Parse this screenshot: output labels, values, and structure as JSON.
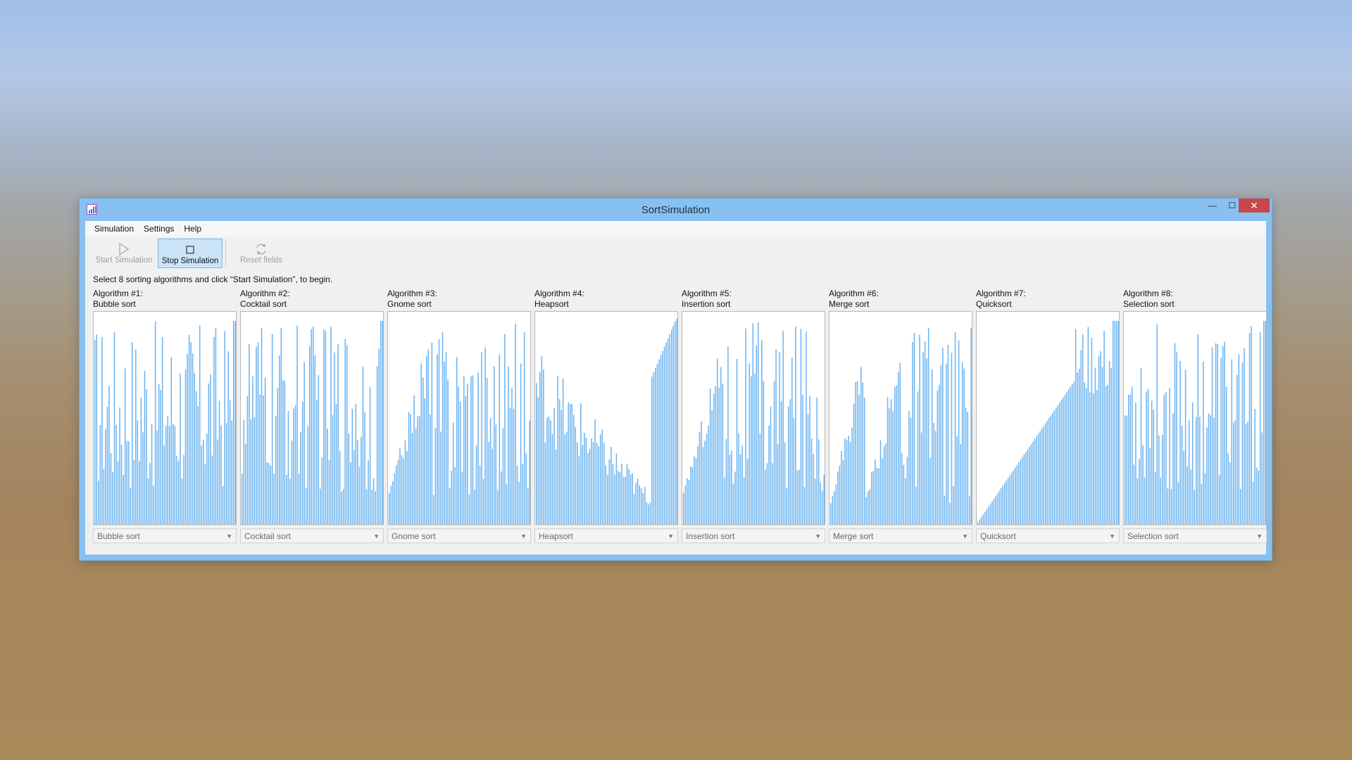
{
  "window": {
    "title": "SortSimulation"
  },
  "menu": {
    "items": [
      "Simulation",
      "Settings",
      "Help"
    ]
  },
  "toolbar": {
    "start_label": "Start Simulation",
    "stop_label": "Stop Simulation",
    "reset_label": "Reset fields"
  },
  "instruction": "Select 8 sorting algorithms and click “Start Simulation”, to begin.",
  "colors": {
    "bar": "#6bb3f0",
    "window_frame": "#88c1f1",
    "close_button": "#c9474a"
  },
  "panels": [
    {
      "heading": "Algorithm #1:",
      "algorithm": "Bubble sort",
      "selected": "Bubble sort",
      "pattern": "random-tail"
    },
    {
      "heading": "Algorithm #2:",
      "algorithm": "Cocktail sort",
      "selected": "Cocktail sort",
      "pattern": "random-tail"
    },
    {
      "heading": "Algorithm #3:",
      "algorithm": "Gnome sort",
      "selected": "Gnome sort",
      "pattern": "partial-ascending"
    },
    {
      "heading": "Algorithm #4:",
      "algorithm": "Heapsort",
      "selected": "Heapsort",
      "pattern": "heap"
    },
    {
      "heading": "Algorithm #5:",
      "algorithm": "Insertion sort",
      "selected": "Insertion sort",
      "pattern": "partial-ascending"
    },
    {
      "heading": "Algorithm #6:",
      "algorithm": "Merge sort",
      "selected": "Merge sort",
      "pattern": "merge"
    },
    {
      "heading": "Algorithm #7:",
      "algorithm": "Quicksort",
      "selected": "Quicksort",
      "pattern": "quick"
    },
    {
      "heading": "Algorithm #8:",
      "algorithm": "Selection sort",
      "selected": "Selection sort",
      "pattern": "random-tail"
    }
  ]
}
